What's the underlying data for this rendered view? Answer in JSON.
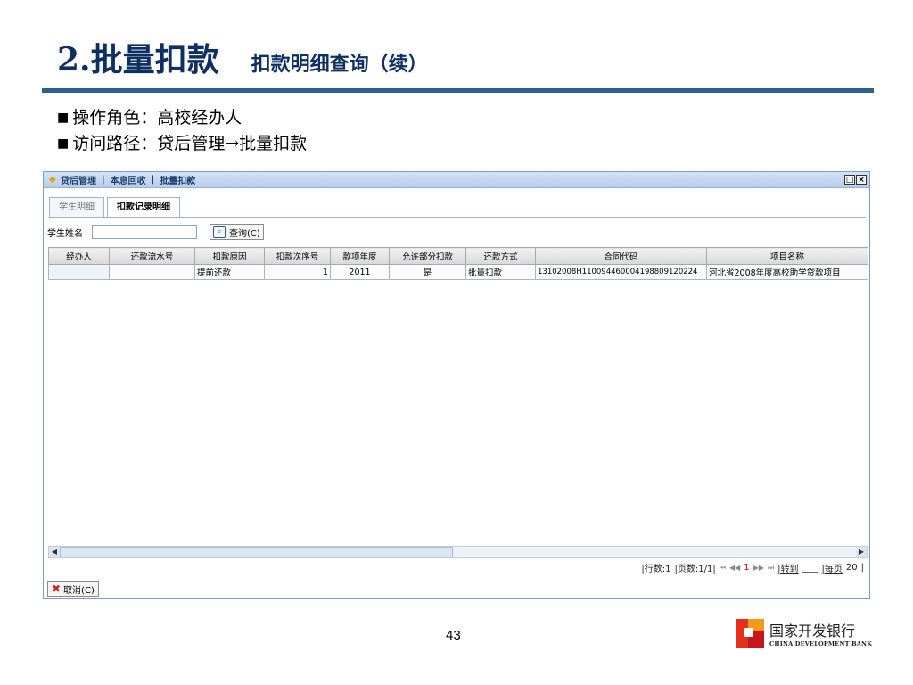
{
  "slide": {
    "title_main": "2.批量扣款",
    "title_sub": "扣款明细查询（续）",
    "bullets": [
      {
        "mark": "■",
        "text": "操作角色：高校经办人"
      },
      {
        "mark": "■",
        "text": "访问路径：贷后管理→批量扣款"
      }
    ],
    "page_number": "43",
    "logo": {
      "cn": "国家开发银行",
      "en": "CHINA DEVELOPMENT BANK"
    }
  },
  "window": {
    "breadcrumb": [
      "贷后管理",
      "本息回收",
      "批量扣款"
    ],
    "separator": "|",
    "controls": {
      "restore": "□",
      "close": "×"
    }
  },
  "tabs": [
    {
      "label": "学生明细",
      "active": false
    },
    {
      "label": "扣款记录明细",
      "active": true
    }
  ],
  "search": {
    "label": "学生姓名",
    "value": "",
    "query_button": "查询(C)"
  },
  "grid": {
    "columns": [
      "经办人",
      "还款流水号",
      "扣款原因",
      "扣款次序号",
      "款项年度",
      "允许部分扣款",
      "还款方式",
      "合同代码",
      "项目名称"
    ],
    "rows": [
      [
        "",
        "",
        "提前还款",
        "1",
        "2011",
        "是",
        "批量扣款",
        "13102008H1100944600041988091202​24",
        "河北省2008年度高校助学贷款项目"
      ]
    ]
  },
  "pager": {
    "rows_text": "|行数:1",
    "pages_text": "|页数:1/1|",
    "first": "⏮",
    "prev": "◀◀",
    "current": "1",
    "next": "▶▶",
    "last": "⏭",
    "goto": "|转到",
    "per_page_label": "|每页",
    "per_page": "20",
    "end": "|"
  },
  "cancel_button": "取消(C)"
}
